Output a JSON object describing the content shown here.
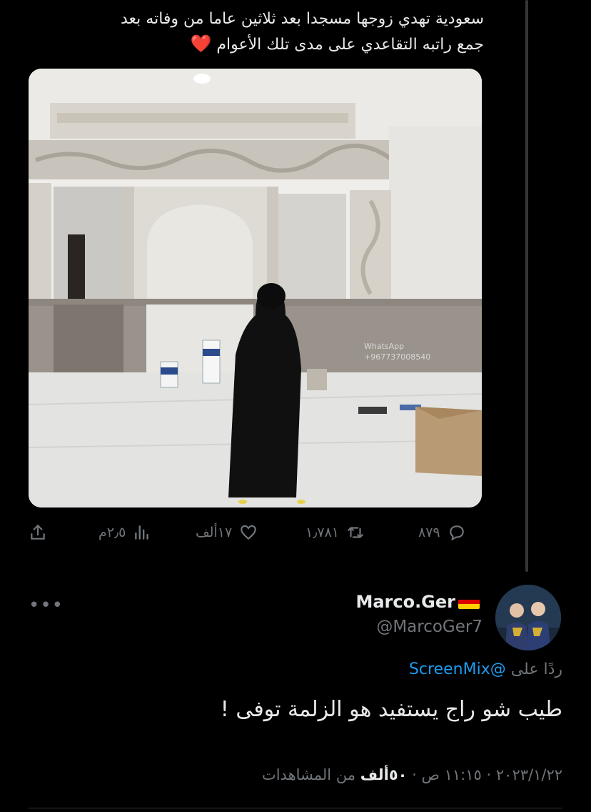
{
  "original_tweet": {
    "text_line1": "سعودية تهدي زوجها مسجدا بعد ثلاثين عاما من وفاته بعد",
    "text_line2": "جمع راتبه التقاعدي على مدى تلك الأعوام",
    "emoji": "❤️",
    "media": {
      "watermark_line1": "WhatsApp",
      "watermark_line2": "+967737008540"
    },
    "actions": {
      "replies": "٨٧٩",
      "retweets": "١٫٧٨١",
      "likes": "١٧ألف",
      "views": "٢٫٥م"
    }
  },
  "reply": {
    "display_name": "Marco.Ger",
    "handle": "@MarcoGer7",
    "replying_prefix": "ردًا على",
    "replying_to": "@ScreenMix",
    "text": "طيب شو راج يستفيد هو الزلمة توفى !",
    "more_label": "•••",
    "date": "٢٠٢٣/١/٢٢",
    "time": "١١:١٥ ص",
    "separator": "·",
    "views_count": "٥٠ألف",
    "views_label": "من المشاهدات"
  },
  "colors": {
    "background": "#000000",
    "text": "#e7e9ea",
    "muted": "#71767b",
    "link": "#1d9bf0",
    "heart": "#f4212e"
  },
  "icons": [
    "reply-icon",
    "retweet-icon",
    "like-icon",
    "views-icon",
    "share-icon",
    "more-icon",
    "heart-emoji",
    "germany-flag"
  ]
}
